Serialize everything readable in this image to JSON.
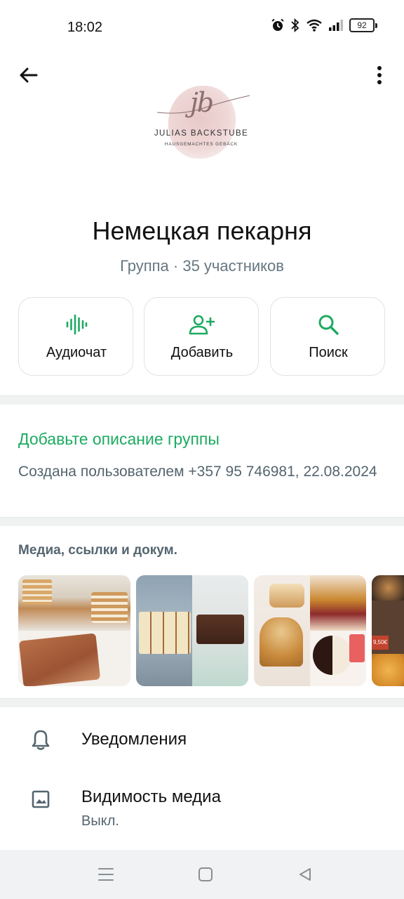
{
  "status_bar": {
    "time": "18:02",
    "battery": "92",
    "icons": [
      "alarm-icon",
      "bluetooth-icon",
      "wifi-icon",
      "signal-icon",
      "battery-icon"
    ]
  },
  "top_bar": {
    "back_icon": "arrow-left-icon",
    "more_icon": "more-vert-icon"
  },
  "logo": {
    "monogram": "jb",
    "name": "JULIAS BACKSTUBE",
    "tagline": "HAUSGEMACHTES GEBÄCK"
  },
  "group": {
    "title": "Немецкая пекарня",
    "subtitle": "Группа · 35 участников"
  },
  "actions": [
    {
      "label": "Аудиочат",
      "icon": "audio-wave-icon"
    },
    {
      "label": "Добавить",
      "icon": "add-person-icon"
    },
    {
      "label": "Поиск",
      "icon": "search-icon"
    }
  ],
  "description": {
    "add_link": "Добавьте описание группы",
    "created": "Создана пользователем +357 95 746981, 22.08.2024"
  },
  "media": {
    "title": "Медиа, ссылки и докум.",
    "thumbnails": [
      "honey-cake-photo",
      "tray-bakes-photo",
      "bundt-cake-photo",
      "bread-price-photo"
    ],
    "price_text": "9,50€"
  },
  "settings": [
    {
      "label": "Уведомления",
      "icon": "bell-icon"
    },
    {
      "label": "Видимость медиа",
      "value": "Выкл.",
      "icon": "image-icon"
    }
  ],
  "nav": [
    "menu-icon",
    "home-square-icon",
    "back-triangle-icon"
  ],
  "colors": {
    "accent": "#1daa61",
    "secondary_text": "#667781",
    "divider": "#f0f2f2"
  }
}
